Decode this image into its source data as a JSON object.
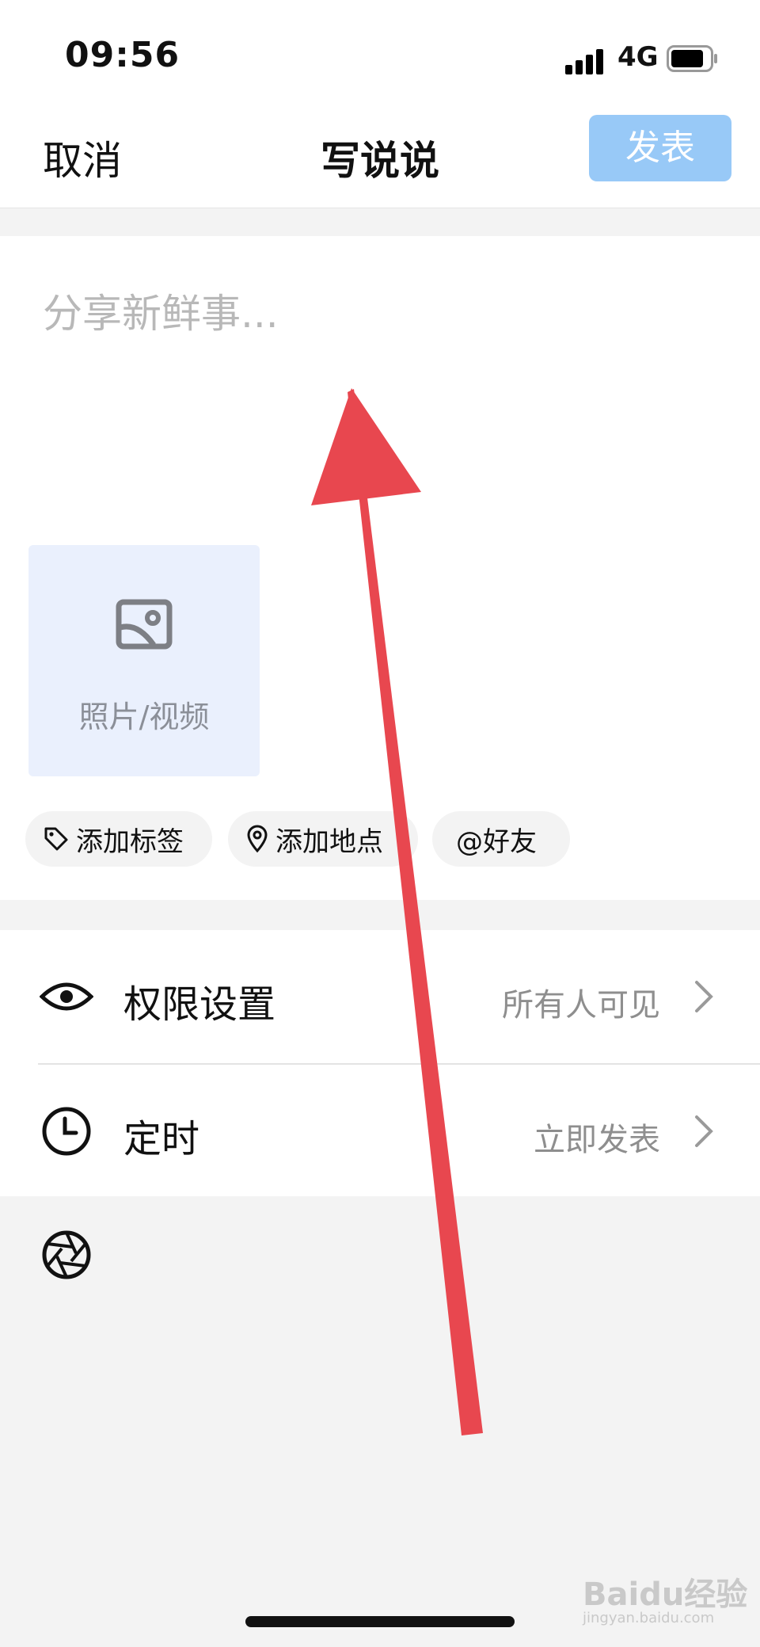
{
  "status_bar": {
    "time": "09:56",
    "network": "4G"
  },
  "nav": {
    "cancel_label": "取消",
    "title": "写说说",
    "publish_label": "发表"
  },
  "compose": {
    "placeholder": "分享新鲜事...",
    "value": ""
  },
  "media": {
    "label": "照片/视频"
  },
  "chips": {
    "tag": "添加标签",
    "location": "添加地点",
    "friend": "@好友"
  },
  "settings": {
    "permission": {
      "label": "权限设置",
      "value": "所有人可见"
    },
    "schedule": {
      "label": "定时",
      "value": "立即发表"
    }
  },
  "watermark": {
    "main": "Baidu经验",
    "sub": "jingyan.baidu.com"
  },
  "colors": {
    "publish_disabled": "#98c9f7",
    "media_tile": "#eaf0fd",
    "arrow": "#e8474f"
  },
  "icons": [
    "signal-icon",
    "battery-icon",
    "photo-icon",
    "tag-icon",
    "location-pin-icon",
    "eye-icon",
    "clock-icon",
    "camera-aperture-icon",
    "chevron-right-icon",
    "arrow-annotation"
  ]
}
